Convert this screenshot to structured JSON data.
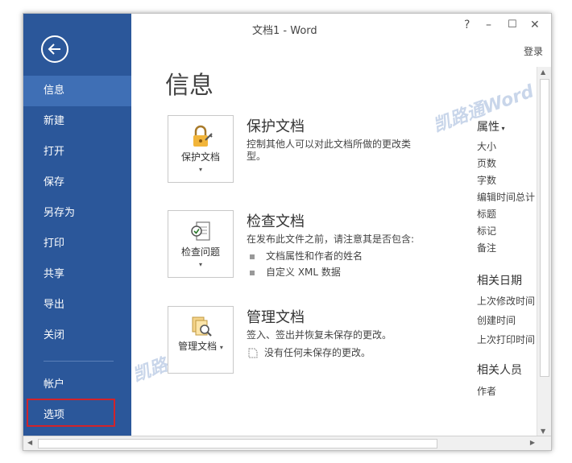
{
  "window": {
    "title": "文档1 - Word"
  },
  "controls": {
    "help": "?",
    "minimize": "–",
    "restore": "☐",
    "close": "✕",
    "login": "登录"
  },
  "sidebar": {
    "items": [
      "信息",
      "新建",
      "打开",
      "保存",
      "另存为",
      "打印",
      "共享",
      "导出",
      "关闭"
    ],
    "bottom": [
      "帐户",
      "选项"
    ]
  },
  "main": {
    "title": "信息",
    "protect": {
      "button": "保护文档",
      "heading": "保护文档",
      "desc": "控制其他人可以对此文档所做的更改类型。"
    },
    "inspect": {
      "button": "检查问题",
      "heading": "检查文档",
      "desc": "在发布此文件之前，请注意其是否包含:",
      "bullets": [
        "文档属性和作者的姓名",
        "自定义 XML 数据"
      ]
    },
    "manage": {
      "button": "管理文档",
      "heading": "管理文档",
      "desc": "签入、签出并恢复未保存的更改。",
      "note": "没有任何未保存的更改。"
    }
  },
  "properties": {
    "header": "属性",
    "items": [
      "大小",
      "页数",
      "字数",
      "编辑时间总计",
      "标题",
      "标记",
      "备注"
    ],
    "dates_header": "相关日期",
    "dates": [
      "上次修改时间",
      "创建时间",
      "上次打印时间"
    ],
    "people_header": "相关人员",
    "people": [
      "作者"
    ]
  },
  "watermark": "凯路通Word",
  "colors": {
    "sidebar": "#2b579a",
    "active": "#3f6fb5",
    "highlight_border": "#d2232a"
  }
}
